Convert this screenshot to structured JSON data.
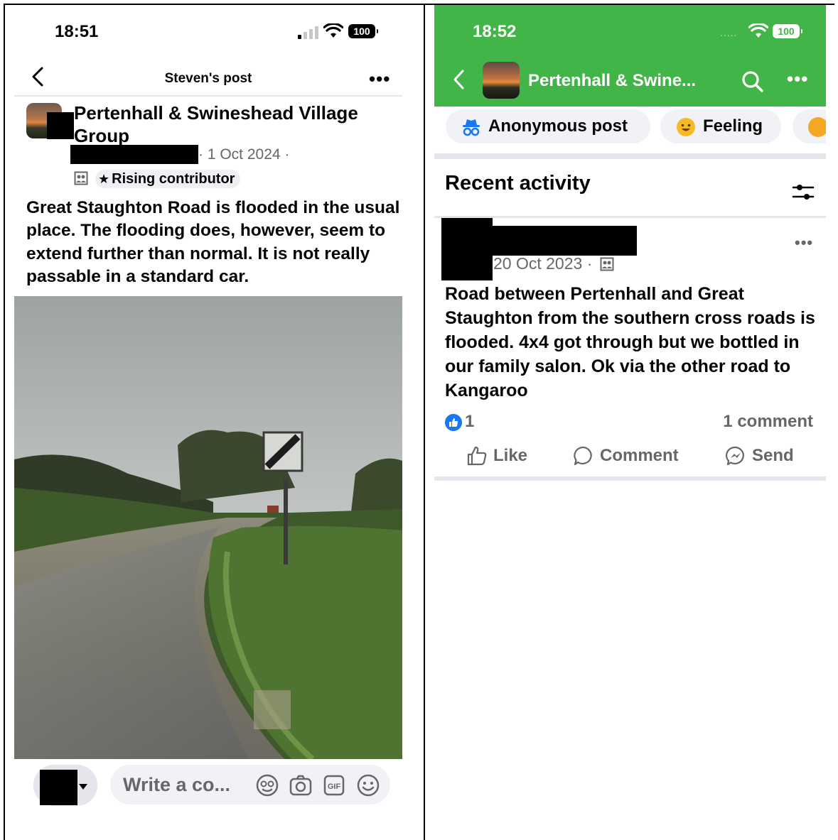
{
  "left_screen": {
    "status_bar": {
      "time": "18:51",
      "battery": "100"
    },
    "nav": {
      "title": "Steven's post"
    },
    "post": {
      "group_name": "Pertenhall & Swineshead Village Group",
      "meta": "· 1 Oct 2024 ·",
      "badge": "Rising contributor",
      "body": "Great Staughton Road is flooded in the usual place. The flooding does, however, seem to extend further than normal. It is not really passable in a standard car."
    },
    "comment_bar": {
      "placeholder": "Write a co..."
    }
  },
  "right_screen": {
    "status_bar": {
      "time": "18:52",
      "battery": "100",
      "dots": "....."
    },
    "header": {
      "title": "Pertenhall & Swine..."
    },
    "chips": [
      {
        "label": "Anonymous post",
        "icon": "anonymous-icon"
      },
      {
        "label": "Feeling",
        "icon": "smile-icon"
      }
    ],
    "section_title": "Recent activity",
    "post": {
      "date": "20 Oct 2023 ·",
      "body": "Road between Pertenhall and Great Staughton from the southern cross roads is flooded. 4x4 got through but we bottled in our family salon. Ok via the other road to Kangaroo",
      "like_count": "1",
      "comment_count": "1 comment"
    },
    "actions": [
      {
        "label": "Like",
        "icon": "thumbs-up-icon"
      },
      {
        "label": "Comment",
        "icon": "comment-bubble-icon"
      },
      {
        "label": "Send",
        "icon": "messenger-icon"
      }
    ]
  },
  "colors": {
    "group_header_green": "#42b549",
    "facebook_blue": "#1877f2",
    "muted_text": "#65676b"
  }
}
